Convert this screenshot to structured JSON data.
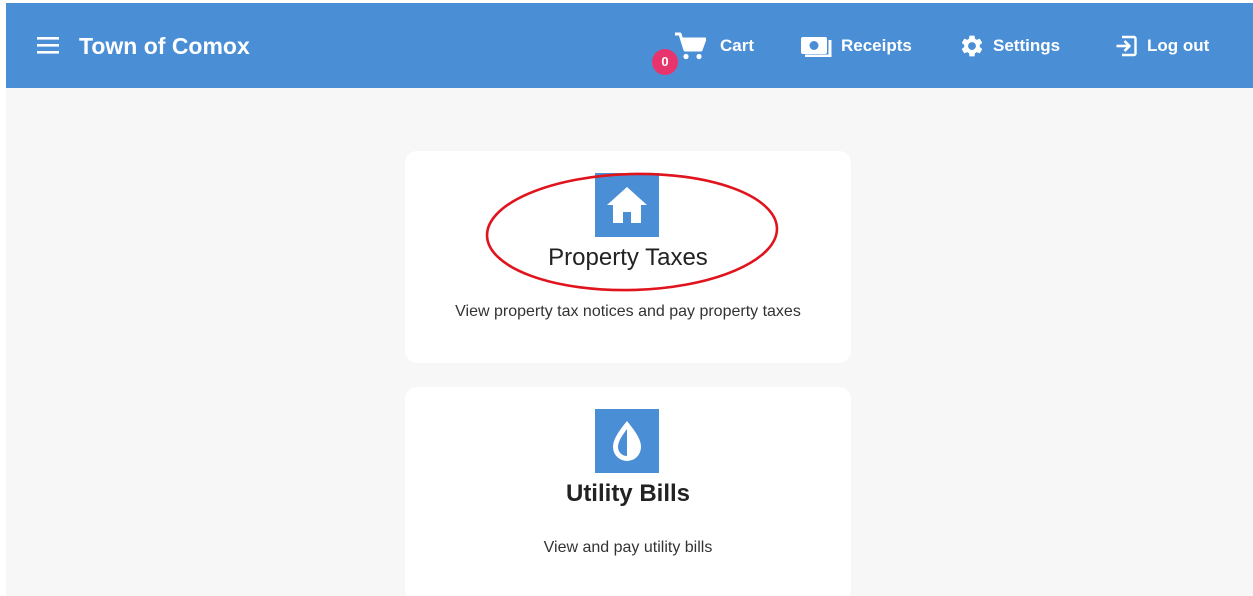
{
  "header": {
    "app_title": "Town of Comox",
    "background_color": "#4a8fd6",
    "nav": {
      "cart_label": "Cart",
      "cart_count": "0",
      "receipts_label": "Receipts",
      "settings_label": "Settings",
      "logout_label": "Log out"
    },
    "icons": [
      "menu-icon",
      "cart-icon",
      "receipt-icon",
      "gear-icon",
      "logout-icon"
    ],
    "badge_color": "#e8346c"
  },
  "cards": [
    {
      "title": "Property Taxes",
      "description": "View property tax notices and pay property taxes",
      "icon": "house-icon",
      "highlighted": true,
      "highlight_color": "#e0141c"
    },
    {
      "title": "Utility Bills",
      "description": "View and pay utility bills",
      "icon": "water-drop-icon",
      "highlighted": false
    }
  ]
}
